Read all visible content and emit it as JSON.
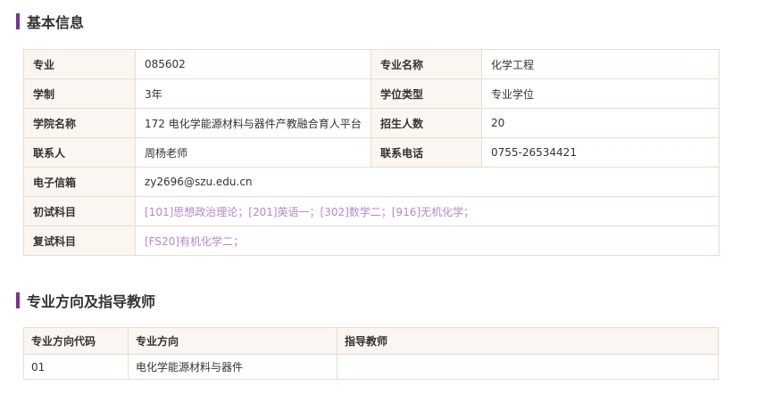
{
  "section1": {
    "title": "基本信息"
  },
  "info": {
    "row1": {
      "label_a": "专业",
      "value_a": "085602",
      "label_b": "专业名称",
      "value_b": "化学工程"
    },
    "row2": {
      "label_a": "学制",
      "value_a": "3年",
      "label_b": "学位类型",
      "value_b": "专业学位"
    },
    "row3": {
      "label_a": "学院名称",
      "value_a": "172 电化学能源材料与器件产教融合育人平台",
      "label_b": "招生人数",
      "value_b": "20"
    },
    "row4": {
      "label_a": "联系人",
      "value_a": "周杨老师",
      "label_b": "联系电话",
      "value_b": "0755-26534421"
    },
    "row5": {
      "label": "电子信箱",
      "value": "zy2696@szu.edu.cn"
    },
    "row6": {
      "label": "初试科目",
      "value": "[101]思想政治理论；[201]英语一；[302]数学二；[916]无机化学；"
    },
    "row7": {
      "label": "复试科目",
      "value": "[FS20]有机化学二；"
    }
  },
  "section2": {
    "title": "专业方向及指导教师"
  },
  "directions": {
    "headers": [
      "专业方向代码",
      "专业方向",
      "指导教师"
    ],
    "rows": [
      [
        "01",
        "电化学能源材料与器件",
        ""
      ]
    ]
  },
  "colors": {
    "accent": "#7d2f91",
    "label_bg": "#fbf6f1",
    "border": "#eadccd",
    "subject_text": "#b586d0"
  }
}
